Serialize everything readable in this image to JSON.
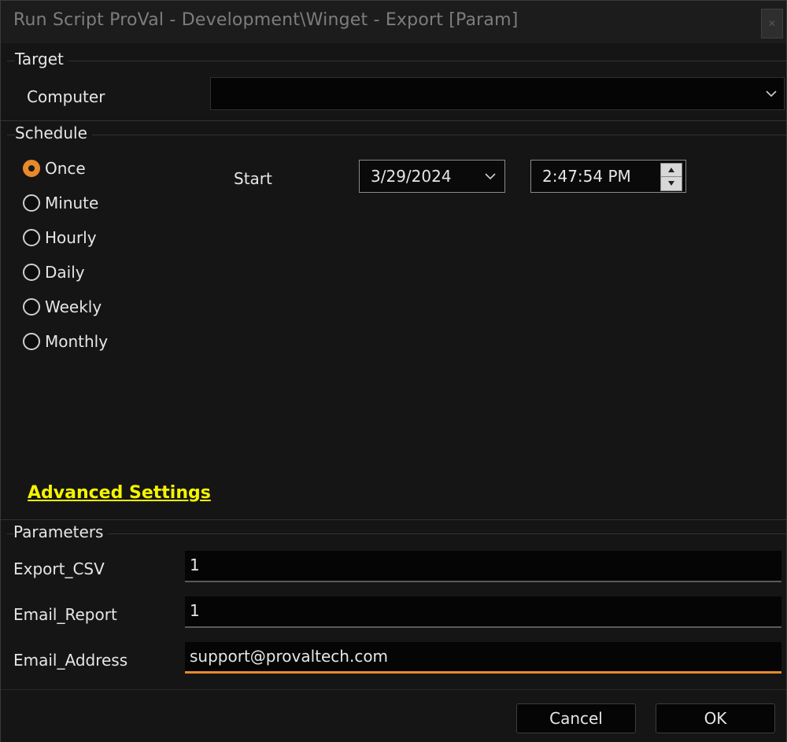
{
  "window": {
    "title": "Run Script ProVal - Development\\Winget - Export [Param]"
  },
  "target": {
    "section_label": "Target",
    "computer_label": "Computer",
    "computer_value": ""
  },
  "schedule": {
    "section_label": "Schedule",
    "options": [
      {
        "label": "Once",
        "selected": true
      },
      {
        "label": "Minute",
        "selected": false
      },
      {
        "label": "Hourly",
        "selected": false
      },
      {
        "label": "Daily",
        "selected": false
      },
      {
        "label": "Weekly",
        "selected": false
      },
      {
        "label": "Monthly",
        "selected": false
      }
    ],
    "start_label": "Start",
    "start_date": "3/29/2024",
    "start_time": "2:47:54 PM"
  },
  "advanced_settings_label": "Advanced Settings",
  "parameters": {
    "section_label": "Parameters",
    "fields": [
      {
        "label": "Export_CSV",
        "value": "1"
      },
      {
        "label": "Email_Report",
        "value": "1"
      },
      {
        "label": "Email_Address",
        "value": "support@provaltech.com"
      }
    ]
  },
  "buttons": {
    "cancel": "Cancel",
    "ok": "OK"
  },
  "colors": {
    "accent": "#e8892b",
    "link": "#f4f400",
    "background": "#151515"
  },
  "icons": [
    "close-icon",
    "chevron-down-icon",
    "spin-up-icon",
    "spin-down-icon"
  ]
}
